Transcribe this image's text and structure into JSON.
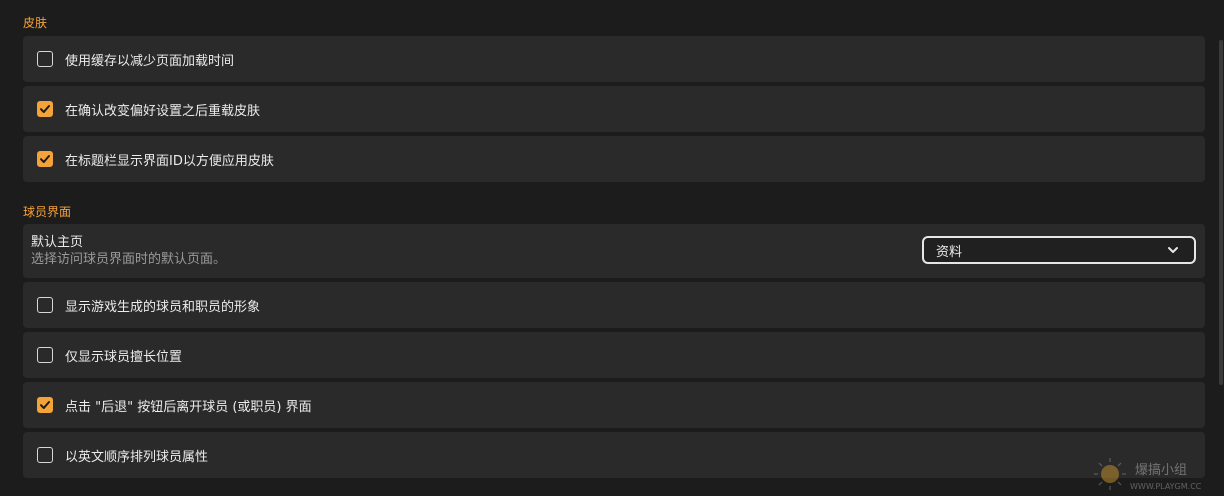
{
  "skin": {
    "header": "皮肤",
    "options": [
      {
        "label": "使用缓存以减少页面加载时间",
        "checked": false
      },
      {
        "label": "在确认改变偏好设置之后重载皮肤",
        "checked": true
      },
      {
        "label": "在标题栏显示界面ID以方便应用皮肤",
        "checked": true
      }
    ]
  },
  "player_screen": {
    "header": "球员界面",
    "default_page": {
      "title": "默认主页",
      "description": "选择访问球员界面时的默认页面。",
      "selected": "资料"
    },
    "options": [
      {
        "label": "显示游戏生成的球员和职员的形象",
        "checked": false
      },
      {
        "label": "仅显示球员擅长位置",
        "checked": false
      },
      {
        "label": "点击 \"后退\" 按钮后离开球员 (或职员) 界面",
        "checked": true
      },
      {
        "label": "以英文顺序排列球员属性",
        "checked": false
      }
    ]
  },
  "colors": {
    "accent": "#f4a23a",
    "row_bg": "#2a2a2a",
    "page_bg": "#1c1c1c"
  },
  "watermark": {
    "site": "WWW.PLAYGM.CC",
    "name": "爆搞小组"
  }
}
